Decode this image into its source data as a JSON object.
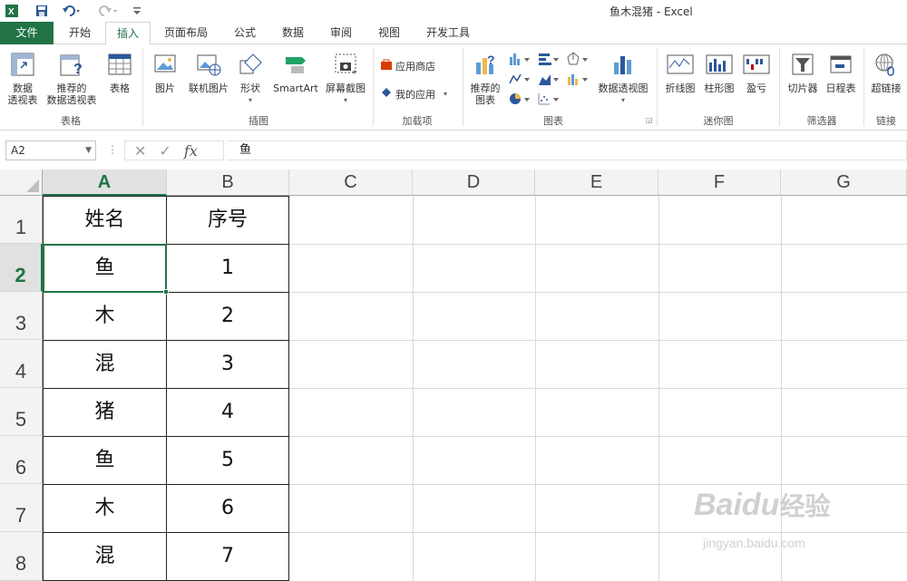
{
  "window": {
    "title": "鱼木混猪 - Excel",
    "app_icon": "excel-icon"
  },
  "quick_access": {
    "save_icon": "save-icon",
    "undo_icon": "undo-icon",
    "redo_icon": "redo-icon",
    "customize_icon": "customize-qat-icon"
  },
  "tabs": [
    "文件",
    "开始",
    "插入",
    "页面布局",
    "公式",
    "数据",
    "审阅",
    "视图",
    "开发工具"
  ],
  "active_tab": "插入",
  "ribbon": {
    "pivot_table": "数据\n透视表",
    "pivot_table_l1": "数据",
    "pivot_table_l2": "透视表",
    "rec_pivot_l1": "推荐的",
    "rec_pivot_l2": "数据透视表",
    "table": "表格",
    "group_tables": "表格",
    "picture": "图片",
    "online_picture": "联机图片",
    "shapes": "形状",
    "smartart": "SmartArt",
    "screenshot": "屏幕截图",
    "group_illustrations": "插图",
    "store": "应用商店",
    "my_apps": "我的应用",
    "group_addins": "加载项",
    "rec_charts_l1": "推荐的",
    "rec_charts_l2": "图表",
    "pivot_chart": "数据透视图",
    "group_charts": "图表",
    "line_spark": "折线图",
    "column_spark": "柱形图",
    "winloss_spark": "盈亏",
    "group_sparklines": "迷你图",
    "slicer": "切片器",
    "timeline": "日程表",
    "group_filters": "筛选器",
    "hyperlink": "超链接",
    "group_links": "链接"
  },
  "formula_bar": {
    "name_box": "A2",
    "formula": "鱼"
  },
  "columns": [
    "A",
    "B",
    "C",
    "D",
    "E",
    "F",
    "G"
  ],
  "rows": [
    "1",
    "2",
    "3",
    "4",
    "5",
    "6",
    "7",
    "8"
  ],
  "table": {
    "headers": [
      "姓名",
      "序号"
    ],
    "rows": [
      [
        "鱼",
        "1"
      ],
      [
        "木",
        "2"
      ],
      [
        "混",
        "3"
      ],
      [
        "猪",
        "4"
      ],
      [
        "鱼",
        "5"
      ],
      [
        "木",
        "6"
      ],
      [
        "混",
        "7"
      ]
    ]
  },
  "watermark": {
    "brand": "Baidu",
    "brand_cn": "经验",
    "url": "jingyan.baidu.com"
  },
  "colors": {
    "accent": "#217346"
  }
}
